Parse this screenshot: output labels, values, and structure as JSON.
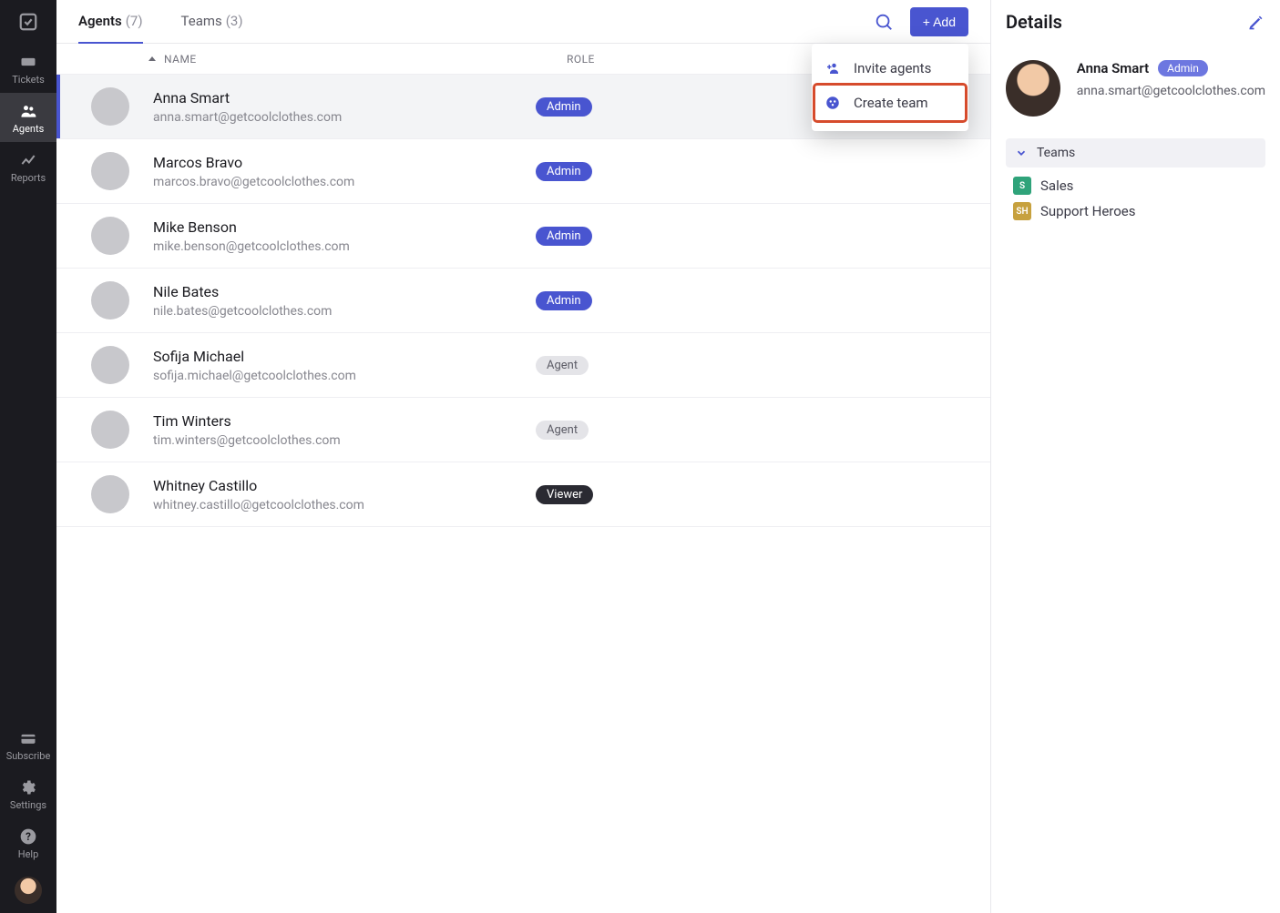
{
  "nav": {
    "tickets": "Tickets",
    "agents": "Agents",
    "reports": "Reports",
    "subscribe": "Subscribe",
    "settings": "Settings",
    "help": "Help"
  },
  "tabs": {
    "agents_label": "Agents",
    "agents_count": "(7)",
    "teams_label": "Teams",
    "teams_count": "(3)"
  },
  "add_button": "+ Add",
  "dropdown": {
    "invite": "Invite agents",
    "create_team": "Create team"
  },
  "columns": {
    "name": "NAME",
    "role": "ROLE"
  },
  "roles": {
    "admin": "Admin",
    "agent": "Agent",
    "viewer": "Viewer"
  },
  "agents": [
    {
      "name": "Anna Smart",
      "email": "anna.smart@getcoolclothes.com",
      "role": "admin",
      "avatar": "av1"
    },
    {
      "name": "Marcos Bravo",
      "email": "marcos.bravo@getcoolclothes.com",
      "role": "admin",
      "avatar": "av2"
    },
    {
      "name": "Mike Benson",
      "email": "mike.benson@getcoolclothes.com",
      "role": "admin",
      "avatar": "av3"
    },
    {
      "name": "Nile Bates",
      "email": "nile.bates@getcoolclothes.com",
      "role": "admin",
      "avatar": "av4"
    },
    {
      "name": "Sofija Michael",
      "email": "sofija.michael@getcoolclothes.com",
      "role": "agent",
      "avatar": "av5"
    },
    {
      "name": "Tim Winters",
      "email": "tim.winters@getcoolclothes.com",
      "role": "agent",
      "avatar": "av6"
    },
    {
      "name": "Whitney Castillo",
      "email": "whitney.castillo@getcoolclothes.com",
      "role": "viewer",
      "avatar": "av7"
    }
  ],
  "details": {
    "title": "Details",
    "name": "Anna Smart",
    "role_label": "Admin",
    "email": "anna.smart@getcoolclothes.com",
    "teams_heading": "Teams",
    "teams": [
      {
        "label": "Sales",
        "chip": "S",
        "chipClass": "tc-green"
      },
      {
        "label": "Support Heroes",
        "chip": "SH",
        "chipClass": "tc-gold"
      }
    ]
  }
}
